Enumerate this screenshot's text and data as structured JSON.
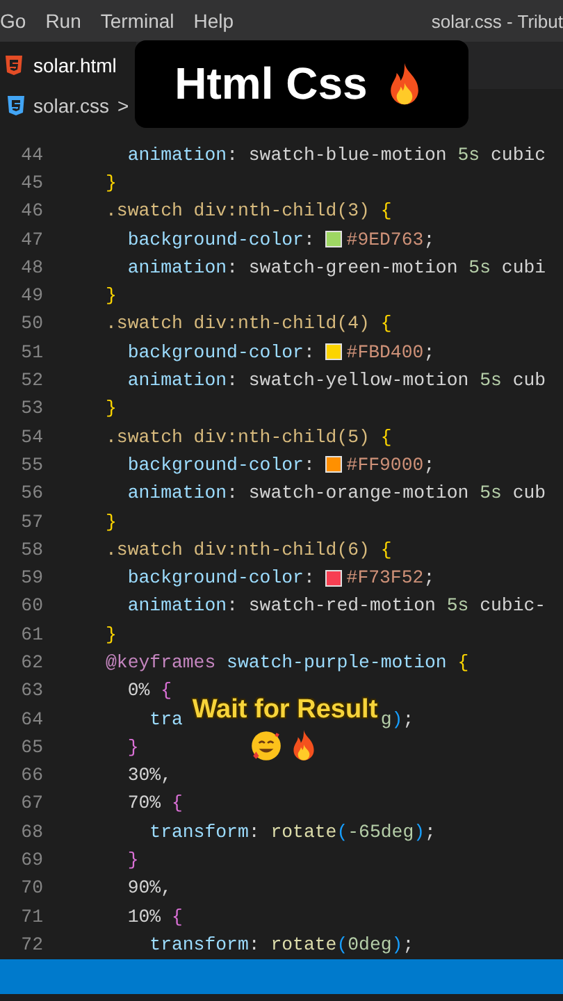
{
  "menu": [
    "Go",
    "Run",
    "Terminal",
    "Help"
  ],
  "window": {
    "title": "solar.css - Tribut"
  },
  "tabs": [
    {
      "label": "solar.html",
      "selected": true
    }
  ],
  "breadcrumb": [
    "solar.css",
    ">"
  ],
  "editor": {
    "lines": [
      {
        "n": "44",
        "tokens": [
          {
            "kind": "prop",
            "t": "  animation"
          },
          {
            "kind": "punct",
            "t": ": "
          },
          {
            "kind": "plain",
            "t": "swatch-blue-motion "
          },
          {
            "kind": "num",
            "t": "5s"
          },
          {
            "kind": "plain",
            "t": " cubic"
          }
        ]
      },
      {
        "n": "45",
        "tokens": [
          {
            "kind": "brace",
            "t": "}"
          }
        ]
      },
      {
        "n": "46",
        "tokens": [
          {
            "kind": "sel",
            "t": ".swatch div:nth-child(3) "
          },
          {
            "kind": "brace",
            "t": "{"
          }
        ]
      },
      {
        "n": "47",
        "tokens": [
          {
            "kind": "prop",
            "t": "  background-color"
          },
          {
            "kind": "punct",
            "t": ": "
          },
          {
            "kind": "swatch",
            "color": "#9ed763"
          },
          {
            "kind": "str",
            "t": "#9ED763"
          },
          {
            "kind": "punct",
            "t": ";"
          }
        ]
      },
      {
        "n": "48",
        "tokens": [
          {
            "kind": "prop",
            "t": "  animation"
          },
          {
            "kind": "punct",
            "t": ": "
          },
          {
            "kind": "plain",
            "t": "swatch-green-motion "
          },
          {
            "kind": "num",
            "t": "5s"
          },
          {
            "kind": "plain",
            "t": " cubi"
          }
        ]
      },
      {
        "n": "49",
        "tokens": [
          {
            "kind": "brace",
            "t": "}"
          }
        ]
      },
      {
        "n": "50",
        "tokens": [
          {
            "kind": "sel",
            "t": ".swatch div:nth-child(4) "
          },
          {
            "kind": "brace",
            "t": "{"
          }
        ]
      },
      {
        "n": "51",
        "tokens": [
          {
            "kind": "prop",
            "t": "  background-color"
          },
          {
            "kind": "punct",
            "t": ": "
          },
          {
            "kind": "swatch",
            "color": "#fbd400"
          },
          {
            "kind": "str",
            "t": "#FBD400"
          },
          {
            "kind": "punct",
            "t": ";"
          }
        ]
      },
      {
        "n": "52",
        "tokens": [
          {
            "kind": "prop",
            "t": "  animation"
          },
          {
            "kind": "punct",
            "t": ": "
          },
          {
            "kind": "plain",
            "t": "swatch-yellow-motion "
          },
          {
            "kind": "num",
            "t": "5s"
          },
          {
            "kind": "plain",
            "t": " cub"
          }
        ]
      },
      {
        "n": "53",
        "tokens": [
          {
            "kind": "brace",
            "t": "}"
          }
        ]
      },
      {
        "n": "54",
        "tokens": [
          {
            "kind": "sel",
            "t": ".swatch div:nth-child(5) "
          },
          {
            "kind": "brace",
            "t": "{"
          }
        ]
      },
      {
        "n": "55",
        "tokens": [
          {
            "kind": "prop",
            "t": "  background-color"
          },
          {
            "kind": "punct",
            "t": ": "
          },
          {
            "kind": "swatch",
            "color": "#ff9000"
          },
          {
            "kind": "str",
            "t": "#FF9000"
          },
          {
            "kind": "punct",
            "t": ";"
          }
        ]
      },
      {
        "n": "56",
        "tokens": [
          {
            "kind": "prop",
            "t": "  animation"
          },
          {
            "kind": "punct",
            "t": ": "
          },
          {
            "kind": "plain",
            "t": "swatch-orange-motion "
          },
          {
            "kind": "num",
            "t": "5s"
          },
          {
            "kind": "plain",
            "t": " cub"
          }
        ]
      },
      {
        "n": "57",
        "tokens": [
          {
            "kind": "brace",
            "t": "}"
          }
        ]
      },
      {
        "n": "58",
        "tokens": [
          {
            "kind": "sel",
            "t": ".swatch div:nth-child(6) "
          },
          {
            "kind": "brace",
            "t": "{"
          }
        ]
      },
      {
        "n": "59",
        "tokens": [
          {
            "kind": "prop",
            "t": "  background-color"
          },
          {
            "kind": "punct",
            "t": ": "
          },
          {
            "kind": "swatch",
            "color": "#f73f52"
          },
          {
            "kind": "str",
            "t": "#F73F52"
          },
          {
            "kind": "punct",
            "t": ";"
          }
        ]
      },
      {
        "n": "60",
        "tokens": [
          {
            "kind": "prop",
            "t": "  animation"
          },
          {
            "kind": "punct",
            "t": ": "
          },
          {
            "kind": "plain",
            "t": "swatch-red-motion "
          },
          {
            "kind": "num",
            "t": "5s"
          },
          {
            "kind": "plain",
            "t": " cubic-"
          }
        ]
      },
      {
        "n": "61",
        "tokens": [
          {
            "kind": "brace",
            "t": "}"
          }
        ]
      },
      {
        "n": "62",
        "tokens": [
          {
            "kind": "kw",
            "t": "@keyframes"
          },
          {
            "kind": "name",
            "t": " swatch-purple-motion "
          },
          {
            "kind": "brace",
            "t": "{"
          }
        ]
      },
      {
        "n": "63",
        "tokens": [
          {
            "kind": "plain",
            "t": "  0% "
          },
          {
            "kind": "brace2",
            "t": "{"
          }
        ]
      },
      {
        "n": "64",
        "tokens": [
          {
            "kind": "prop",
            "t": "    tra"
          },
          {
            "kind": "tail",
            "t": "g"
          },
          {
            "kind": "paren",
            "t": ")"
          },
          {
            "kind": "punct",
            "t": ";"
          }
        ]
      },
      {
        "n": "65",
        "tokens": [
          {
            "kind": "brace2",
            "t": "  }"
          }
        ]
      },
      {
        "n": "66",
        "tokens": [
          {
            "kind": "plain",
            "t": "  30%,"
          }
        ]
      },
      {
        "n": "67",
        "tokens": [
          {
            "kind": "plain",
            "t": "  70% "
          },
          {
            "kind": "brace2",
            "t": "{"
          }
        ]
      },
      {
        "n": "68",
        "tokens": [
          {
            "kind": "prop",
            "t": "    transform"
          },
          {
            "kind": "punct",
            "t": ": "
          },
          {
            "kind": "fn",
            "t": "rotate"
          },
          {
            "kind": "paren",
            "t": "("
          },
          {
            "kind": "num",
            "t": "-65deg"
          },
          {
            "kind": "paren",
            "t": ")"
          },
          {
            "kind": "punct",
            "t": ";"
          }
        ]
      },
      {
        "n": "69",
        "tokens": [
          {
            "kind": "brace2",
            "t": "  }"
          }
        ]
      },
      {
        "n": "70",
        "tokens": [
          {
            "kind": "plain",
            "t": "  90%,"
          }
        ]
      },
      {
        "n": "71",
        "tokens": [
          {
            "kind": "plain",
            "t": "  10% "
          },
          {
            "kind": "brace2",
            "t": "{"
          }
        ]
      },
      {
        "n": "72",
        "tokens": [
          {
            "kind": "prop",
            "t": "    transform"
          },
          {
            "kind": "punct",
            "t": ": "
          },
          {
            "kind": "fn",
            "t": "rotate"
          },
          {
            "kind": "paren",
            "t": "("
          },
          {
            "kind": "num",
            "t": "0deg"
          },
          {
            "kind": "paren",
            "t": ")"
          },
          {
            "kind": "punct",
            "t": ";"
          }
        ]
      }
    ]
  },
  "captions": [
    {
      "kind": "title",
      "text": "Html Css"
    },
    {
      "kind": "subtitle",
      "text": "Wait for Result"
    }
  ]
}
